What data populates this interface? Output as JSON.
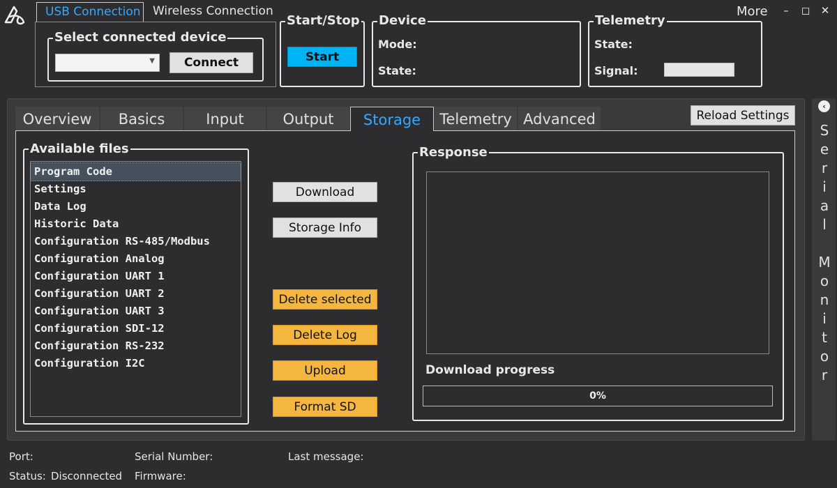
{
  "connection_tabs": {
    "usb": "USB Connection",
    "wireless": "Wireless Connection"
  },
  "select_device": {
    "legend": "Select connected device",
    "combo_value": "",
    "connect_label": "Connect"
  },
  "start_stop": {
    "legend": "Start/Stop",
    "start_label": "Start"
  },
  "device": {
    "legend": "Device",
    "mode_label": "Mode:",
    "state_label": "State:"
  },
  "telemetry": {
    "legend": "Telemetry",
    "state_label": "State:",
    "signal_label": "Signal:"
  },
  "window": {
    "more_label": "More",
    "minimize": "–",
    "maximize": "◻",
    "close": "✕"
  },
  "tabs": [
    {
      "label": "Overview"
    },
    {
      "label": "Basics"
    },
    {
      "label": "Input"
    },
    {
      "label": "Output"
    },
    {
      "label": "Storage"
    },
    {
      "label": "Telemetry"
    },
    {
      "label": "Advanced"
    }
  ],
  "reload_label": "Reload Settings",
  "files": {
    "legend": "Available files",
    "items": [
      "Program Code",
      "Settings",
      "Data Log",
      "Historic Data",
      "Configuration RS-485/Modbus",
      "Configuration Analog",
      "Configuration UART 1",
      "Configuration UART 2",
      "Configuration UART 3",
      "Configuration SDI-12",
      "Configuration RS-232",
      "Configuration I2C"
    ],
    "selected_index": 0
  },
  "actions": {
    "download": "Download",
    "storage_info": "Storage Info",
    "delete_selected": "Delete selected",
    "delete_log": "Delete Log",
    "upload": "Upload",
    "format_sd": "Format SD"
  },
  "response": {
    "legend": "Response",
    "progress_label": "Download progress",
    "progress_text": "0%",
    "progress_value": 0
  },
  "serial_monitor": {
    "toggle_icon": "chevron-left-icon",
    "label": "Serial Monitor",
    "toggle_glyph": "‹"
  },
  "status": {
    "port_label": "Port:",
    "status_label": "Status:",
    "status_value": "Disconnected",
    "serial_label": "Serial Number:",
    "firmware_label": "Firmware:",
    "last_message_label": "Last message:"
  },
  "colors": {
    "accent": "#35a8ff",
    "start_button": "#00b3f5",
    "warning_button": "#f5b63f",
    "background": "#2d2d30"
  }
}
